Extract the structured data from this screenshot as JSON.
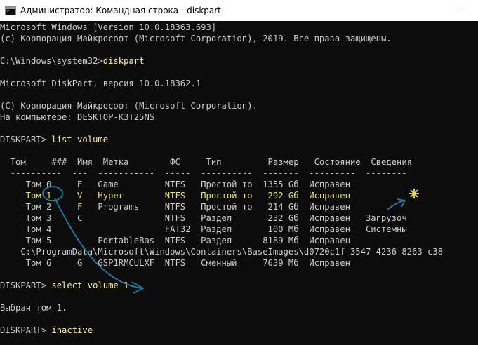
{
  "window": {
    "title": "Администратор: Командная строка - diskpart"
  },
  "console": {
    "lines": [
      "Microsoft Windows [Version 10.0.18363.693]",
      "(c) Корпорация Майкрософт (Microsoft Corporation), 2019. Все права защищены.",
      "",
      "",
      "",
      "Microsoft DiskPart, версия 10.0.18362.1",
      "",
      "(C) Корпорация Майкрософт (Microsoft Corporation).",
      "На компьютере: DESKTOP-K3T25NS",
      "",
      "",
      "",
      "  Том     ###  Имя  Метка        ФС     Тип         Размер   Состояние  Сведения",
      "  ----------  ---  -----------  -----  ----------  -------  ---------  --------",
      "     Том 0     E   Game         NTFS   Простой то  1355 Gб  Исправен",
      "",
      "     Том 2     F   Programs     NTFS   Простой то   214 Gб  Исправен",
      "     Том 3     C                NTFS   Раздел       232 Gб  Исправен   Загрузоч",
      "     Том 4                      FAT32  Раздел       100 Мб  Исправен   Системны",
      "     Том 5         PortableBas  NTFS   Раздел      8189 Мб  Исправен",
      "    C:\\ProgramData\\Microsoft\\Windows\\Containers\\BaseImages\\d0720c1f-3547-4236-8263-c38",
      "     Том 6     G   GSP1RMCULXF  NTFS   Сменный     7639 Мб  Исправен",
      "",
      "",
      "",
      "Выбран том 1.",
      "",
      ""
    ],
    "prompt_lines": [
      {
        "prompt": "C:\\Windows\\system32>",
        "command": "diskpart"
      },
      {
        "prompt": "DISKPART> ",
        "command": "list volume"
      },
      {
        "prompt": "DISKPART> ",
        "command": "select volume 1"
      },
      {
        "prompt": "DISKPART> ",
        "command": "inactive"
      }
    ],
    "highlighted_row": "     Том 1     V   Hyper        NTFS   Простой то   292 Gб  Исправен"
  },
  "colors": {
    "background": "#0c0c0c",
    "text": "#cccccc",
    "input_text": "#f9f1a5",
    "highlight_text": "#e5e07a",
    "annotation": "#1a82a8",
    "star": "#f5e040"
  }
}
